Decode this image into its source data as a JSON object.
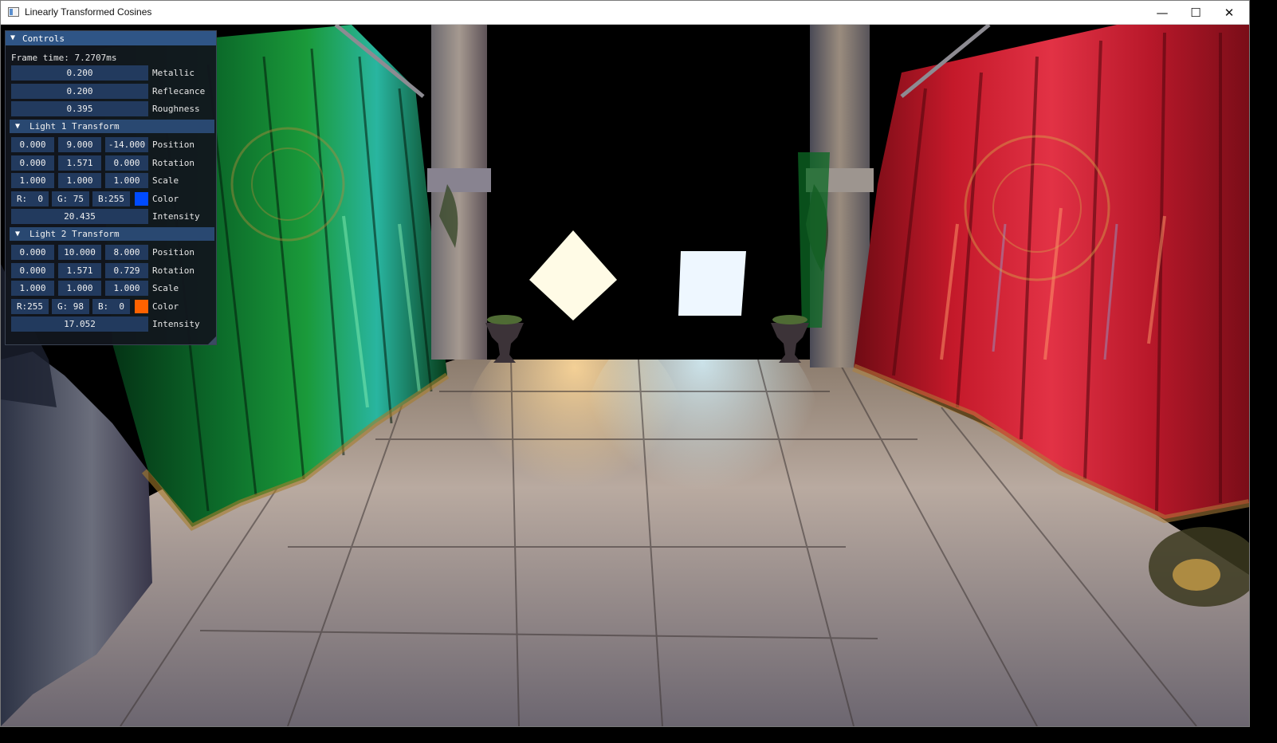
{
  "window": {
    "title": "Linearly Transformed Cosines",
    "buttons": {
      "minimize": "—",
      "maximize": "☐",
      "close": "✕"
    }
  },
  "controls": {
    "title": "Controls",
    "frame_time": "Frame time: 7.2707ms",
    "material": [
      {
        "value": "0.200",
        "label": "Metallic"
      },
      {
        "value": "0.200",
        "label": "Reflecance"
      },
      {
        "value": "0.395",
        "label": "Roughness"
      }
    ],
    "light1": {
      "header": "Light 1 Transform",
      "position": {
        "values": [
          "0.000",
          "9.000",
          "-14.000"
        ],
        "label": "Position"
      },
      "rotation": {
        "values": [
          "0.000",
          "1.571",
          "0.000"
        ],
        "label": "Rotation"
      },
      "scale": {
        "values": [
          "1.000",
          "1.000",
          "1.000"
        ],
        "label": "Scale"
      },
      "color": {
        "values": [
          "R:  0",
          "G: 75",
          "B:255"
        ],
        "label": "Color",
        "swatch": "#004bff"
      },
      "intensity": {
        "value": "20.435",
        "label": "Intensity"
      }
    },
    "light2": {
      "header": "Light 2 Transform",
      "position": {
        "values": [
          "0.000",
          "10.000",
          "8.000"
        ],
        "label": "Position"
      },
      "rotation": {
        "values": [
          "0.000",
          "1.571",
          "0.729"
        ],
        "label": "Rotation"
      },
      "scale": {
        "values": [
          "1.000",
          "1.000",
          "1.000"
        ],
        "label": "Scale"
      },
      "color": {
        "values": [
          "R:255",
          "G: 98",
          "B:  0"
        ],
        "label": "Color",
        "swatch": "#ff6200"
      },
      "intensity": {
        "value": "17.052",
        "label": "Intensity"
      }
    }
  },
  "colors": {
    "panel_title": "#2f5586",
    "field": "#223a5e",
    "header": "#294871"
  }
}
